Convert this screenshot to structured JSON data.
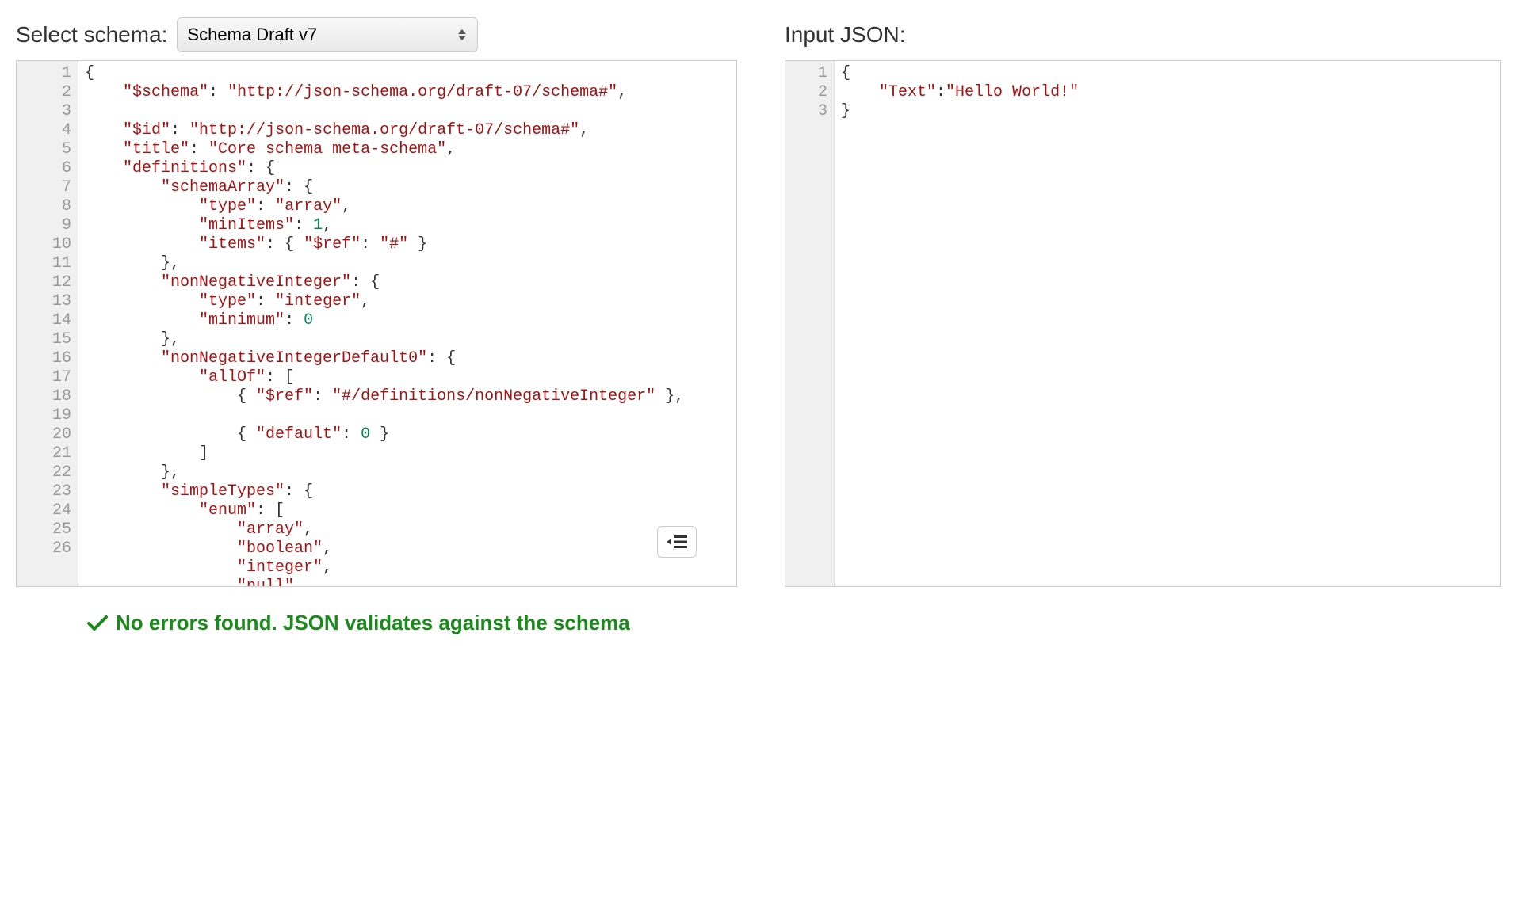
{
  "left": {
    "label": "Select schema:",
    "select_value": "Schema Draft v7",
    "gutter": [
      "1",
      "2",
      "3",
      "4",
      "5",
      "6",
      "7",
      "8",
      "9",
      "10",
      "11",
      "12",
      "13",
      "14",
      "15",
      "16",
      "17",
      "18",
      "19",
      "20",
      "21",
      "22",
      "23",
      "24",
      "25",
      "26"
    ],
    "lines": [
      {
        "indent": 0,
        "tokens": [
          [
            "punc",
            "{"
          ]
        ]
      },
      {
        "indent": 1,
        "wrap": true,
        "tokens": [
          [
            "key",
            "\"$schema\""
          ],
          [
            "punc",
            ": "
          ],
          [
            "str",
            "\"http://json-schema.org/draft-07/schema#\""
          ],
          [
            "punc",
            ","
          ]
        ]
      },
      {
        "indent": 1,
        "tokens": [
          [
            "key",
            "\"$id\""
          ],
          [
            "punc",
            ": "
          ],
          [
            "str",
            "\"http://json-schema.org/draft-07/schema#\""
          ],
          [
            "punc",
            ","
          ]
        ]
      },
      {
        "indent": 1,
        "tokens": [
          [
            "key",
            "\"title\""
          ],
          [
            "punc",
            ": "
          ],
          [
            "str",
            "\"Core schema meta-schema\""
          ],
          [
            "punc",
            ","
          ]
        ]
      },
      {
        "indent": 1,
        "tokens": [
          [
            "key",
            "\"definitions\""
          ],
          [
            "punc",
            ": {"
          ]
        ]
      },
      {
        "indent": 2,
        "tokens": [
          [
            "key",
            "\"schemaArray\""
          ],
          [
            "punc",
            ": {"
          ]
        ]
      },
      {
        "indent": 3,
        "tokens": [
          [
            "key",
            "\"type\""
          ],
          [
            "punc",
            ": "
          ],
          [
            "str",
            "\"array\""
          ],
          [
            "punc",
            ","
          ]
        ]
      },
      {
        "indent": 3,
        "tokens": [
          [
            "key",
            "\"minItems\""
          ],
          [
            "punc",
            ": "
          ],
          [
            "num",
            "1"
          ],
          [
            "punc",
            ","
          ]
        ]
      },
      {
        "indent": 3,
        "tokens": [
          [
            "key",
            "\"items\""
          ],
          [
            "punc",
            ": { "
          ],
          [
            "key",
            "\"$ref\""
          ],
          [
            "punc",
            ": "
          ],
          [
            "str",
            "\"#\""
          ],
          [
            "punc",
            " }"
          ]
        ]
      },
      {
        "indent": 2,
        "tokens": [
          [
            "punc",
            "},"
          ]
        ]
      },
      {
        "indent": 2,
        "tokens": [
          [
            "key",
            "\"nonNegativeInteger\""
          ],
          [
            "punc",
            ": {"
          ]
        ]
      },
      {
        "indent": 3,
        "tokens": [
          [
            "key",
            "\"type\""
          ],
          [
            "punc",
            ": "
          ],
          [
            "str",
            "\"integer\""
          ],
          [
            "punc",
            ","
          ]
        ]
      },
      {
        "indent": 3,
        "tokens": [
          [
            "key",
            "\"minimum\""
          ],
          [
            "punc",
            ": "
          ],
          [
            "num",
            "0"
          ]
        ]
      },
      {
        "indent": 2,
        "tokens": [
          [
            "punc",
            "},"
          ]
        ]
      },
      {
        "indent": 2,
        "tokens": [
          [
            "key",
            "\"nonNegativeIntegerDefault0\""
          ],
          [
            "punc",
            ": {"
          ]
        ]
      },
      {
        "indent": 3,
        "tokens": [
          [
            "key",
            "\"allOf\""
          ],
          [
            "punc",
            ": ["
          ]
        ]
      },
      {
        "indent": 4,
        "wrap": true,
        "tokens": [
          [
            "punc",
            "{ "
          ],
          [
            "key",
            "\"$ref\""
          ],
          [
            "punc",
            ": "
          ],
          [
            "str",
            "\"#/definitions/nonNegativeInteger\""
          ],
          [
            "punc",
            " },"
          ]
        ]
      },
      {
        "indent": 4,
        "tokens": [
          [
            "punc",
            "{ "
          ],
          [
            "key",
            "\"default\""
          ],
          [
            "punc",
            ": "
          ],
          [
            "num",
            "0"
          ],
          [
            "punc",
            " }"
          ]
        ]
      },
      {
        "indent": 3,
        "tokens": [
          [
            "punc",
            "]"
          ]
        ]
      },
      {
        "indent": 2,
        "tokens": [
          [
            "punc",
            "},"
          ]
        ]
      },
      {
        "indent": 2,
        "tokens": [
          [
            "key",
            "\"simpleTypes\""
          ],
          [
            "punc",
            ": {"
          ]
        ]
      },
      {
        "indent": 3,
        "tokens": [
          [
            "key",
            "\"enum\""
          ],
          [
            "punc",
            ": ["
          ]
        ]
      },
      {
        "indent": 4,
        "tokens": [
          [
            "str",
            "\"array\""
          ],
          [
            "punc",
            ","
          ]
        ]
      },
      {
        "indent": 4,
        "tokens": [
          [
            "str",
            "\"boolean\""
          ],
          [
            "punc",
            ","
          ]
        ]
      },
      {
        "indent": 4,
        "tokens": [
          [
            "str",
            "\"integer\""
          ],
          [
            "punc",
            ","
          ]
        ]
      },
      {
        "indent": 4,
        "tokens": [
          [
            "str",
            "\"null\""
          ],
          [
            "punc",
            ","
          ]
        ]
      }
    ]
  },
  "right": {
    "label": "Input JSON:",
    "gutter": [
      "1",
      "2",
      "3"
    ],
    "lines": [
      {
        "indent": 0,
        "tokens": [
          [
            "punc",
            "{"
          ]
        ]
      },
      {
        "indent": 1,
        "tokens": [
          [
            "key",
            "\"Text\""
          ],
          [
            "punc",
            ":"
          ],
          [
            "str",
            "\"Hello World!\""
          ]
        ]
      },
      {
        "indent": 0,
        "tokens": [
          [
            "punc",
            "}"
          ]
        ]
      }
    ]
  },
  "validation": {
    "message": "No errors found. JSON validates against the schema"
  }
}
